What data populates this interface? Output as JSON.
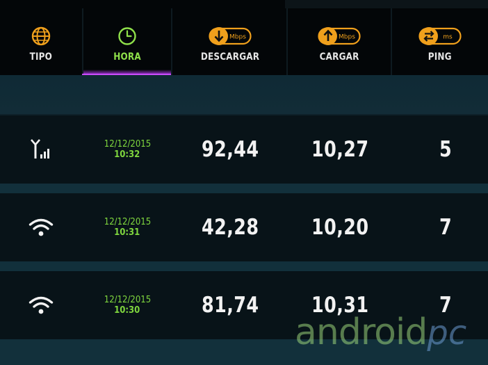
{
  "header": {
    "columns": [
      {
        "id": "tipo",
        "label": "TIPO",
        "icon": "globe-icon",
        "active": false
      },
      {
        "id": "hora",
        "label": "HORA",
        "icon": "clock-icon",
        "active": true
      },
      {
        "id": "descargar",
        "label": "DESCARGAR",
        "icon": "download-mbps-icon",
        "unit": "Mbps",
        "active": false
      },
      {
        "id": "cargar",
        "label": "CARGAR",
        "icon": "upload-mbps-icon",
        "unit": "Mbps",
        "active": false
      },
      {
        "id": "ping",
        "label": "PING",
        "icon": "ping-ms-icon",
        "unit": "ms",
        "active": false
      }
    ]
  },
  "results": [
    {
      "type_icon": "cellular-signal-icon",
      "date": "12/12/2015",
      "time": "10:32",
      "download": "92,44",
      "upload": "10,27",
      "ping": "5"
    },
    {
      "type_icon": "wifi-icon",
      "date": "12/12/2015",
      "time": "10:31",
      "download": "42,28",
      "upload": "10,20",
      "ping": "7"
    },
    {
      "type_icon": "wifi-icon",
      "date": "12/12/2015",
      "time": "10:30",
      "download": "81,74",
      "upload": "10,31",
      "ping": "7"
    }
  ],
  "watermark": {
    "main": "android",
    "accent": "pc"
  },
  "colors": {
    "accent_orange": "#f0a01c",
    "active_green": "#8fe04a",
    "active_underline": "#c94bff",
    "row_bg": "#081318",
    "separator": "#12303b"
  }
}
